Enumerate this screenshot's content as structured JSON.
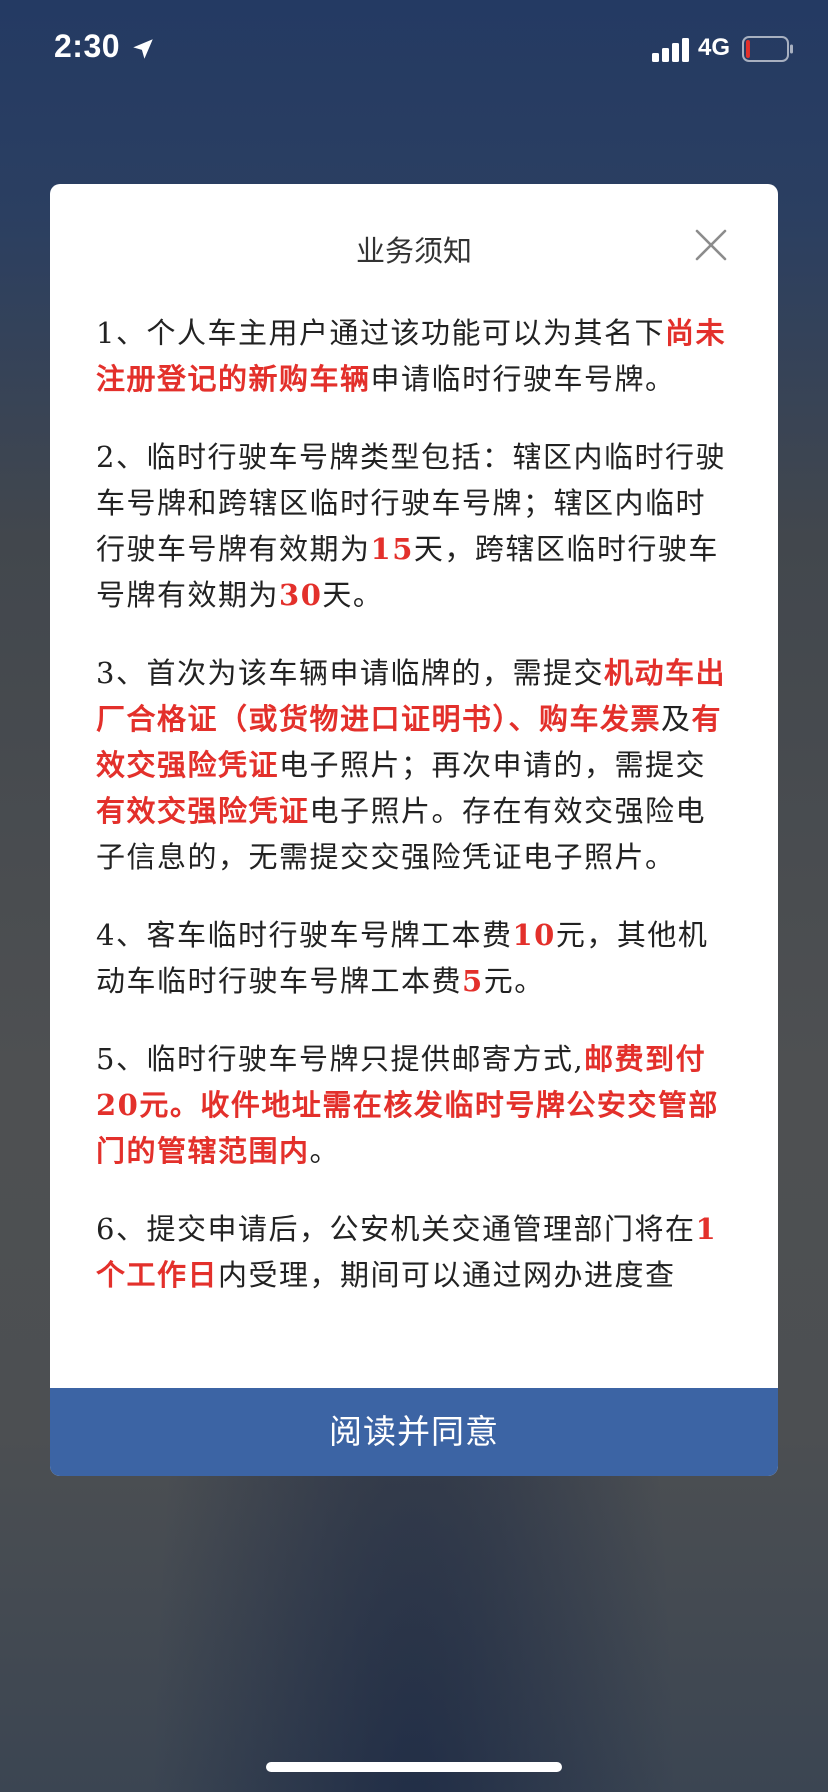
{
  "status_bar": {
    "time": "2:30",
    "network": "4G",
    "location_icon": "location-arrow-icon",
    "signal_icon": "signal-bars-icon",
    "battery_icon": "battery-low-icon",
    "battery_level": 0.05,
    "battery_color": "#e3302b"
  },
  "dialog": {
    "title": "业务须知",
    "close_icon": "close-icon",
    "accent_color": "#e3302b",
    "button_color": "#3c64a4",
    "paragraphs": [
      [
        {
          "t": "1、个人车主用户通过该功能可以为其名下",
          "hl": false
        },
        {
          "t": "尚未注册登记的新购车辆",
          "hl": true
        },
        {
          "t": "申请临时行驶车号牌。",
          "hl": false
        }
      ],
      [
        {
          "t": "2、临时行驶车号牌类型包括：辖区内临时行驶车号牌和跨辖区临时行驶车号牌；辖区内临时行驶车号牌有效期为",
          "hl": false
        },
        {
          "t": "15",
          "hl": true
        },
        {
          "t": "天，跨辖区临时行驶车号牌有效期为",
          "hl": false
        },
        {
          "t": "30",
          "hl": true
        },
        {
          "t": "天。",
          "hl": false
        }
      ],
      [
        {
          "t": "3、首次为该车辆申请临牌的，需提交",
          "hl": false
        },
        {
          "t": "机动车出厂合格证（或货物进口证明书）、购车发票",
          "hl": true
        },
        {
          "t": "及",
          "hl": false
        },
        {
          "t": "有效交强险凭证",
          "hl": true
        },
        {
          "t": "电子照片；再次申请的，需提交",
          "hl": false
        },
        {
          "t": "有效交强险凭证",
          "hl": true
        },
        {
          "t": "电子照片。存在有效交强险电子信息的，无需提交交强险凭证电子照片。",
          "hl": false
        }
      ],
      [
        {
          "t": "4、客车临时行驶车号牌工本费",
          "hl": false
        },
        {
          "t": "10",
          "hl": true
        },
        {
          "t": "元，其他机动车临时行驶车号牌工本费",
          "hl": false
        },
        {
          "t": "5",
          "hl": true
        },
        {
          "t": "元。",
          "hl": false
        }
      ],
      [
        {
          "t": "5、临时行驶车号牌只提供邮寄方式,",
          "hl": false
        },
        {
          "t": "邮费到付20元。收件地址需在核发临时号牌公安交管部门的管辖范围内",
          "hl": true
        },
        {
          "t": "。",
          "hl": false
        }
      ],
      [
        {
          "t": "6、提交申请后，公安机关交通管理部门将在",
          "hl": false
        },
        {
          "t": "1个工作日",
          "hl": true
        },
        {
          "t": "内受理，期间可以通过网办进度查",
          "hl": false
        }
      ]
    ],
    "agree_label": "阅读并同意"
  }
}
